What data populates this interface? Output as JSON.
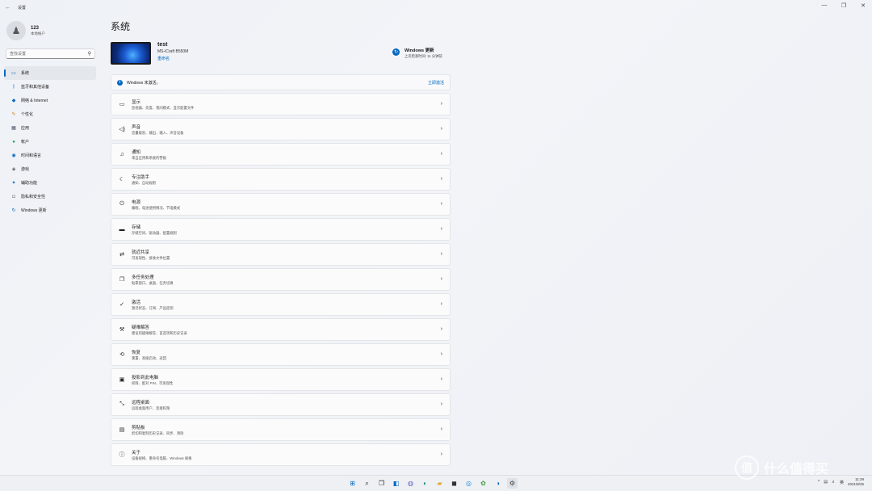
{
  "window": {
    "title": "设置",
    "back": "←",
    "controls": [
      "—",
      "❐",
      "✕"
    ]
  },
  "user": {
    "name": "123",
    "type": "本地帐户",
    "avatar_icon": "person-icon"
  },
  "search": {
    "placeholder": "查找设置"
  },
  "nav": [
    {
      "label": "系统",
      "icon": "monitor-icon",
      "glyph": "▭",
      "color": "#0067c0",
      "active": true
    },
    {
      "label": "蓝牙和其他设备",
      "icon": "bluetooth-icon",
      "glyph": "ᛒ",
      "color": "#0067c0"
    },
    {
      "label": "网络 & Internet",
      "icon": "wifi-icon",
      "glyph": "◆",
      "color": "#0067c0"
    },
    {
      "label": "个性化",
      "icon": "brush-icon",
      "glyph": "✎",
      "color": "#d47a1c"
    },
    {
      "label": "应用",
      "icon": "apps-icon",
      "glyph": "▦",
      "color": "#4a5568"
    },
    {
      "label": "帐户",
      "icon": "account-icon",
      "glyph": "●",
      "color": "#1d9c5c"
    },
    {
      "label": "时间和语言",
      "icon": "globe-icon",
      "glyph": "◉",
      "color": "#0067c0"
    },
    {
      "label": "游戏",
      "icon": "gamepad-icon",
      "glyph": "◈",
      "color": "#555"
    },
    {
      "label": "辅助功能",
      "icon": "accessibility-icon",
      "glyph": "✦",
      "color": "#0067c0"
    },
    {
      "label": "隐私和安全性",
      "icon": "shield-icon",
      "glyph": "◘",
      "color": "#777"
    },
    {
      "label": "Windows 更新",
      "icon": "update-icon",
      "glyph": "↻",
      "color": "#0067c0"
    }
  ],
  "main": {
    "title": "系统",
    "device": {
      "name": "test",
      "model": "MS-iCraft B550M",
      "rename": "重命名"
    },
    "update": {
      "title": "Windows 更新",
      "subtitle": "上次检查时间: 11 分钟前"
    },
    "activation": {
      "text": "Windows 未激活。",
      "button": "立即激活"
    },
    "cards": [
      {
        "title": "显示",
        "desc": "监视器、亮度、夜间模式、显示配置文件",
        "icon": "display-icon",
        "glyph": "▭"
      },
      {
        "title": "声音",
        "desc": "音量级别、输出、输入、声音设备",
        "icon": "speaker-icon",
        "glyph": "◁)"
      },
      {
        "title": "通知",
        "desc": "来自应用和系统的警报",
        "icon": "bell-icon",
        "glyph": "♫"
      },
      {
        "title": "专注助手",
        "desc": "通知、自动规则",
        "icon": "moon-icon",
        "glyph": "☾"
      },
      {
        "title": "电源",
        "desc": "睡眠、电池使用情况、节电模式",
        "icon": "power-icon",
        "glyph": "⏻"
      },
      {
        "title": "存储",
        "desc": "存储空间、驱动器、配置规则",
        "icon": "storage-icon",
        "glyph": "▬"
      },
      {
        "title": "就近共享",
        "desc": "可发现性、接收文件位置",
        "icon": "share-icon",
        "glyph": "⇄"
      },
      {
        "title": "多任务处理",
        "desc": "贴靠窗口、桌面、任务切换",
        "icon": "multitask-icon",
        "glyph": "❐"
      },
      {
        "title": "激活",
        "desc": "激活状态、订阅、产品密钥",
        "icon": "check-circle-icon",
        "glyph": "✓"
      },
      {
        "title": "疑难解答",
        "desc": "建议的疑难解答、首选项和历史记录",
        "icon": "wrench-icon",
        "glyph": "⚒"
      },
      {
        "title": "恢复",
        "desc": "重置、高级启动、返回",
        "icon": "recovery-icon",
        "glyph": "⟲"
      },
      {
        "title": "投影到此电脑",
        "desc": "权限、配对 PIN、可发现性",
        "icon": "project-icon",
        "glyph": "▣"
      },
      {
        "title": "远程桌面",
        "desc": "远程桌面用户、连接权限",
        "icon": "remote-icon",
        "glyph": "⤡"
      },
      {
        "title": "剪贴板",
        "desc": "剪切和复制历史记录、同步、清除",
        "icon": "clipboard-icon",
        "glyph": "▤"
      },
      {
        "title": "关于",
        "desc": "设备规格、重命名电脑、Windows 规格",
        "icon": "info-icon",
        "glyph": "ⓘ"
      }
    ]
  },
  "taskbar": {
    "icons": [
      {
        "name": "start-icon",
        "glyph": "⊞",
        "color": "#0067c0"
      },
      {
        "name": "search-icon",
        "glyph": "⌕",
        "color": "#222"
      },
      {
        "name": "task-view-icon",
        "glyph": "❐",
        "color": "#222"
      },
      {
        "name": "widgets-icon",
        "glyph": "◧",
        "color": "#0067c0"
      },
      {
        "name": "chat-icon",
        "glyph": "◍",
        "color": "#5b5fc7"
      },
      {
        "name": "edge-icon",
        "glyph": "◐",
        "color": "#0f8a7e"
      },
      {
        "name": "explorer-icon",
        "glyph": "▰",
        "color": "#e2a82b"
      },
      {
        "name": "store-icon",
        "glyph": "◼",
        "color": "#333"
      },
      {
        "name": "app-icon-1",
        "glyph": "◎",
        "color": "#1e88e5"
      },
      {
        "name": "app-icon-2",
        "glyph": "✿",
        "color": "#43a047"
      },
      {
        "name": "app-icon-3",
        "glyph": "◑",
        "color": "#0067c0"
      },
      {
        "name": "settings-icon",
        "glyph": "⚙",
        "color": "#444",
        "active": true
      }
    ],
    "tray": {
      "chevron": "^",
      "lang": "英",
      "time": "11:29",
      "date": "2021/8/25"
    }
  },
  "watermark": {
    "text": "什么值得买",
    "glyph": "值"
  }
}
